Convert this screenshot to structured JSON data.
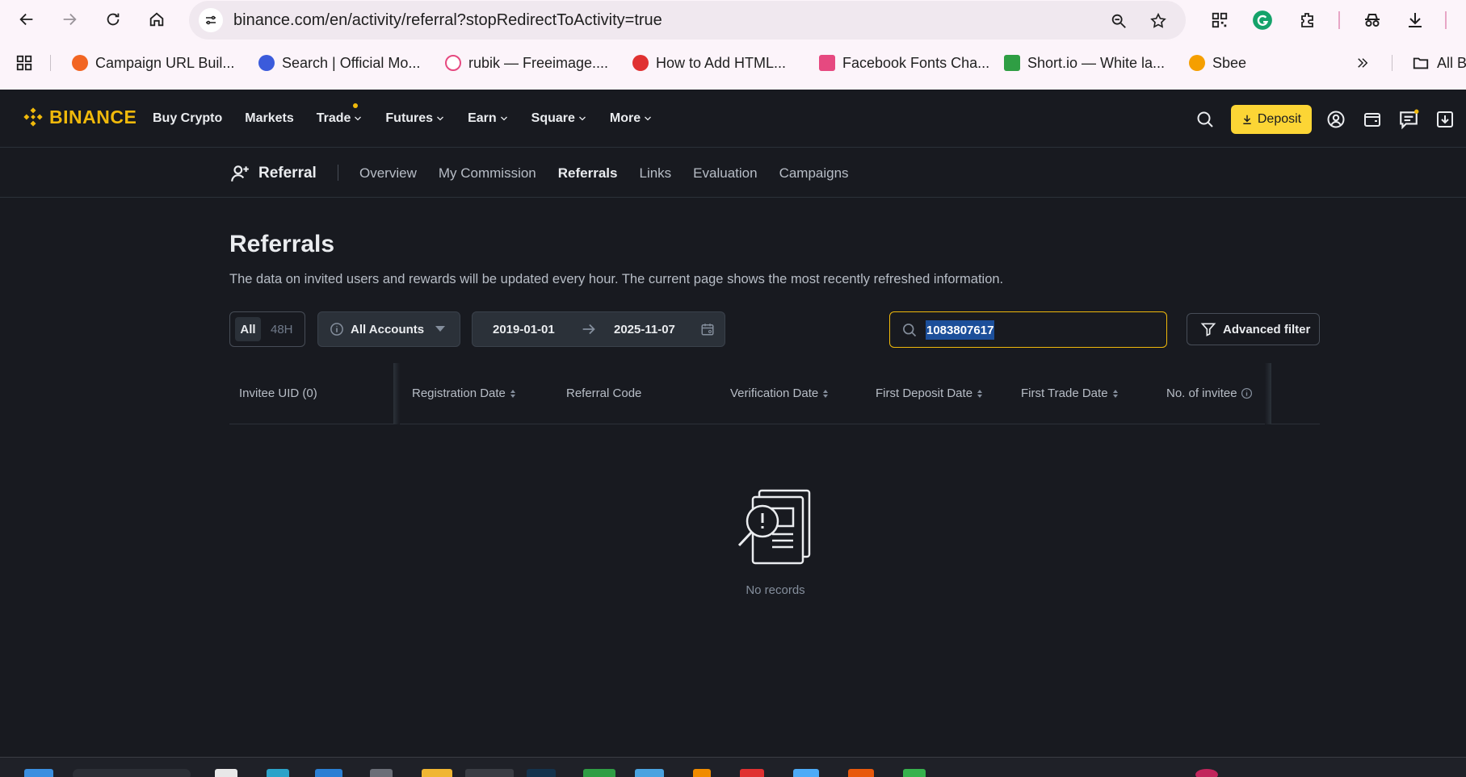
{
  "browser": {
    "url": "binance.com/en/activity/referral?stopRedirectToActivity=true",
    "bookmarks": [
      {
        "label": "Campaign URL Buil...",
        "color": "#f26522"
      },
      {
        "label": "Search | Official Mo...",
        "color": "#3b5bdb"
      },
      {
        "label": "rubik — Freeimage....",
        "color": "#e64980"
      },
      {
        "label": "How to Add HTML...",
        "color": "#e03131"
      },
      {
        "label": "Facebook Fonts Cha...",
        "color": "#e64980"
      },
      {
        "label": "Short.io — White la...",
        "color": "#2f9e44"
      },
      {
        "label": "Sbee",
        "color": "#f59f00"
      },
      {
        "label": "All B",
        "color": "#444"
      }
    ]
  },
  "header": {
    "logo": "BINANCE",
    "nav": [
      {
        "label": "Buy Crypto",
        "dropdown": false
      },
      {
        "label": "Markets",
        "dropdown": false
      },
      {
        "label": "Trade",
        "dropdown": true
      },
      {
        "label": "Futures",
        "dropdown": true
      },
      {
        "label": "Earn",
        "dropdown": true
      },
      {
        "label": "Square",
        "dropdown": true
      },
      {
        "label": "More",
        "dropdown": true
      }
    ],
    "deposit_label": "Deposit",
    "accent": "#f0b90b"
  },
  "subnav": {
    "title": "Referral",
    "tabs": [
      "Overview",
      "My Commission",
      "Referrals",
      "Links",
      "Evaluation",
      "Campaigns"
    ],
    "active_tab": "Referrals"
  },
  "main": {
    "title": "Referrals",
    "description": "The data on invited users and rewards will be updated every hour. The current page shows the most recently refreshed information.",
    "filters": {
      "period_all": "All",
      "period_48h": "48H",
      "accounts": "All Accounts",
      "start_date": "2019-01-01",
      "end_date": "2025-11-07",
      "search_value": "1083807617",
      "advanced_filter": "Advanced filter"
    },
    "table": {
      "columns": [
        {
          "label": "Invitee UID (0)",
          "sortable": false
        },
        {
          "label": "Registration Date",
          "sortable": true
        },
        {
          "label": "Referral Code",
          "sortable": false
        },
        {
          "label": "Verification Date",
          "sortable": true
        },
        {
          "label": "First Deposit Date",
          "sortable": true
        },
        {
          "label": "First Trade Date",
          "sortable": true
        },
        {
          "label": "No. of invitee",
          "sortable": false,
          "info": true
        }
      ],
      "rows": [],
      "empty_text": "No records"
    }
  }
}
